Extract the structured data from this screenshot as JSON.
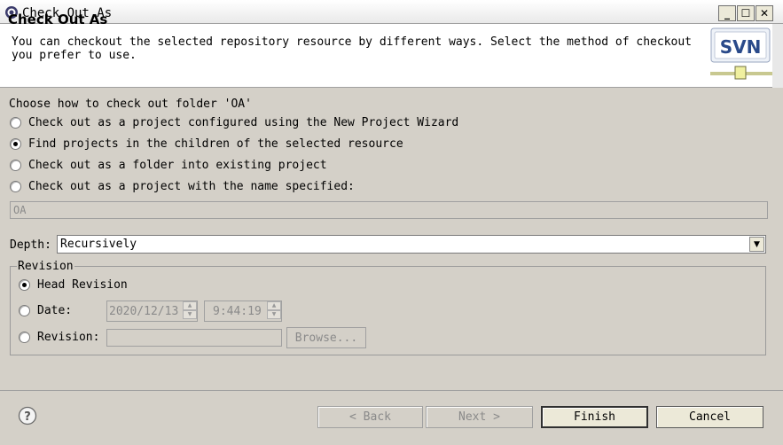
{
  "window": {
    "title": "Check Out As",
    "controls": {
      "minimize": "_",
      "maximize": "☐",
      "close": "✕"
    }
  },
  "header": {
    "title": "Check Out As",
    "description": "You can checkout the selected repository resource by different ways. Select the method of checkout you prefer to use.",
    "logo_text": "SVN"
  },
  "checkout": {
    "choose_label": "Choose how to check out folder 'OA'",
    "options": [
      {
        "label": "Check out as a project configured using the New Project Wizard",
        "selected": false
      },
      {
        "label": "Find projects in the children of the selected resource",
        "selected": true
      },
      {
        "label": "Check out as a folder into existing project",
        "selected": false
      },
      {
        "label": "Check out as a project with the name specified:",
        "selected": false
      }
    ],
    "project_name_value": "OA"
  },
  "depth": {
    "label": "Depth:",
    "selected": "Recursively"
  },
  "revision": {
    "group_label": "Revision",
    "head_label": "Head Revision",
    "head_selected": true,
    "date_label": "Date:",
    "date_value": "2020/12/13",
    "time_value": "9:44:19",
    "revision_label": "Revision:",
    "revision_value": "",
    "browse_label": "Browse..."
  },
  "buttons": {
    "back": "< Back",
    "next": "Next >",
    "finish": "Finish",
    "cancel": "Cancel"
  }
}
